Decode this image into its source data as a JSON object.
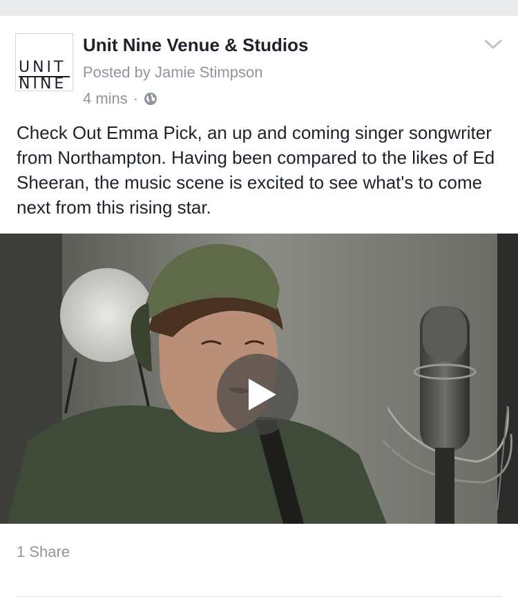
{
  "post": {
    "page_logo": {
      "line1": "UNIT",
      "line2": "NINE"
    },
    "page_name": "Unit Nine Venue & Studios",
    "posted_by": "Posted by Jamie Stimpson",
    "timestamp": "4 mins",
    "separator": "·",
    "privacy_icon": "globe-icon",
    "menu_icon": "chevron-down-icon",
    "text": "Check Out Emma Pick, an up and coming singer songwriter from Northampton. Having been compared to the likes of Ed Sheeran, the music scene is excited to see what's to come next from this rising star.",
    "video": {
      "play_icon": "play-icon"
    },
    "share_count": "1 Share"
  },
  "colors": {
    "text_primary": "#1d2129",
    "text_secondary": "#90949c",
    "background_strip": "#e9ebee",
    "divider": "#dadde1"
  }
}
